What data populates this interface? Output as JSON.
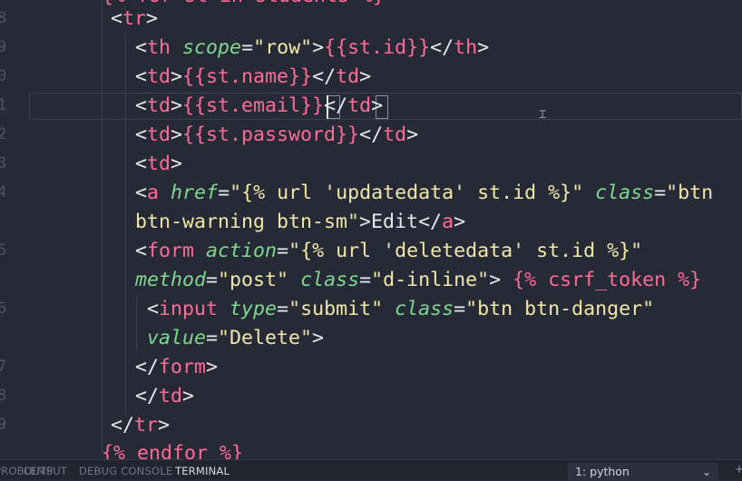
{
  "editor": {
    "top_cut": "{% for st in students %}",
    "lines": [
      {
        "num": "8"
      },
      {
        "num": "9"
      },
      {
        "num": "0"
      },
      {
        "num": "1"
      },
      {
        "num": "2"
      },
      {
        "num": "3"
      },
      {
        "num": "4"
      },
      {
        "num": ""
      },
      {
        "num": "5"
      },
      {
        "num": ""
      },
      {
        "num": "6"
      },
      {
        "num": ""
      },
      {
        "num": "7"
      },
      {
        "num": "8"
      },
      {
        "num": "9"
      }
    ],
    "bottom_cut": "{% endfor %}",
    "tokens": {
      "tr": "tr",
      "th": "th",
      "td": "td",
      "a": "a",
      "form": "form",
      "input": "input",
      "scope": "scope",
      "row": "\"row\"",
      "st_id": "{{st.id}}",
      "st_name": "{{st.name}}",
      "st_email": "{{st.email}}",
      "st_password": "{{st.password}}",
      "href": "href",
      "href_val": "\"{% url 'updatedata' st.id %}\"",
      "class": "class",
      "btn_start": "\"btn",
      "btn_end": "btn-warning btn-sm\"",
      "edit": "Edit",
      "action": "action",
      "action_val": "\"{% url 'deletedata' st.id %}\"",
      "method": "method",
      "post": "\"post\"",
      "d_inline": "\"d-inline\"",
      "csrf": "{% csrf_token %}",
      "type": "type",
      "submit": "\"submit\"",
      "btn_danger": "\"btn btn-danger\"",
      "value": "value",
      "delete": "\"Delete\""
    }
  },
  "panel": {
    "tabs": [
      "PROBLEMS",
      "OUTPUT",
      "DEBUG CONSOLE",
      "TERMINAL"
    ],
    "active_tab": "TERMINAL",
    "terminal_select": "1: python",
    "chevron_icon": "chevron-down-icon"
  },
  "colors": {
    "background": "#262a36",
    "tag": "#ff6b97",
    "attribute": "#7fd88f",
    "string": "#f1e7a8",
    "text": "#e8e9ee"
  }
}
